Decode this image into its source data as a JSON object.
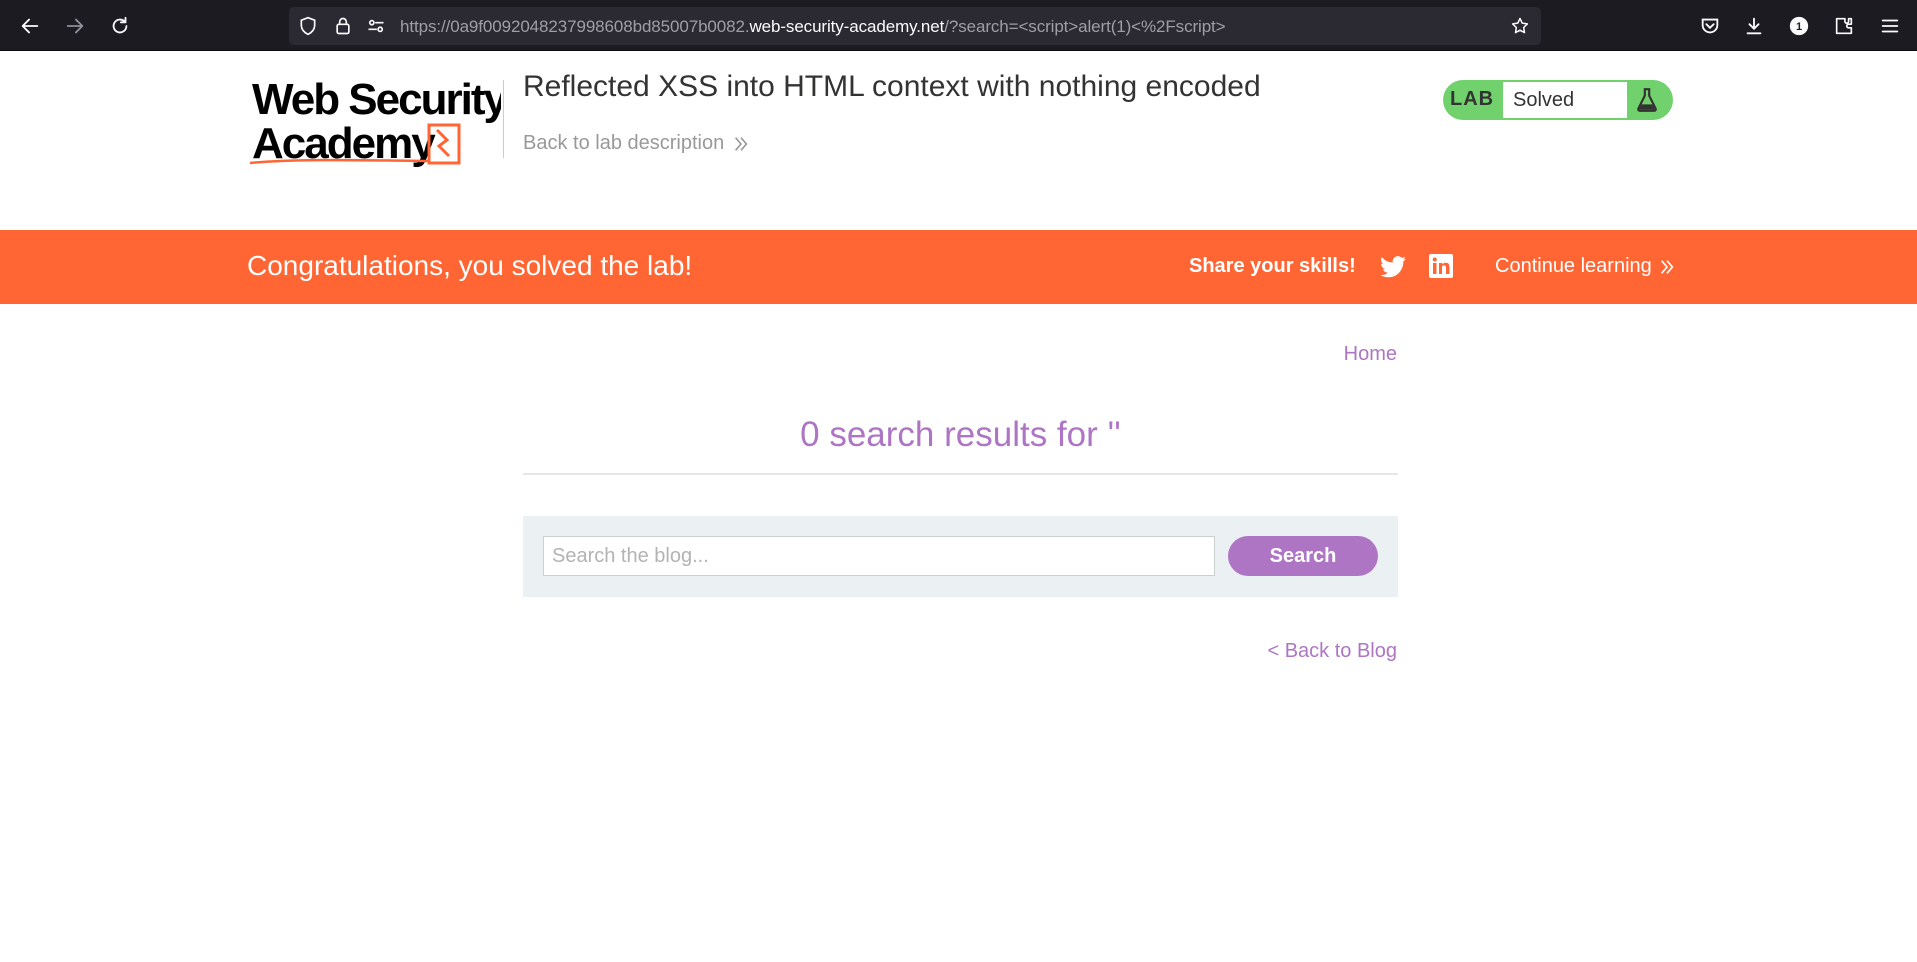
{
  "browser": {
    "url_prefix": "https://0a9f0092048237998608bd85007b0082.",
    "url_host": "web-security-academy.net",
    "url_suffix": "/?search=<script>alert(1)<%2Fscript>",
    "extension_badge": "1",
    "icons": [
      "back-arrow-icon",
      "forward-arrow-icon",
      "reload-icon",
      "shield-icon",
      "lock-icon",
      "permissions-icon",
      "bookmark-star-icon",
      "pocket-icon",
      "download-icon",
      "account-icon",
      "extensions-icon",
      "menu-icon"
    ]
  },
  "header": {
    "logo_line1": "Web Security",
    "logo_line2": "Academy",
    "lab_title": "Reflected XSS into HTML context with nothing encoded",
    "back_link": "Back to lab description",
    "lab_status_label": "LAB",
    "lab_status_value": "Solved",
    "status_color": "#70d16d"
  },
  "banner": {
    "message": "Congratulations, you solved the lab!",
    "share_label": "Share your skills!",
    "continue_label": "Continue learning",
    "color": "#ff6633"
  },
  "blog": {
    "home_link": "Home",
    "results_heading": "0 search results for ''",
    "search_placeholder": "Search the blog...",
    "search_button": "Search",
    "back_to_blog": "< Back to Blog",
    "accent_color": "#ae75c5"
  }
}
